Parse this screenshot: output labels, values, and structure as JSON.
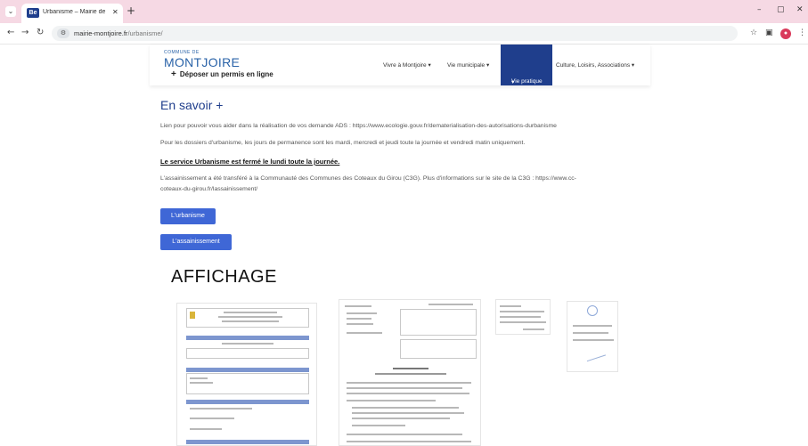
{
  "browser": {
    "tab_title": "Urbanisme – Mairie de Montjo",
    "tab_favicon": "Be",
    "url_host": "mairie-montjoire.fr",
    "url_path": "/urbanisme/"
  },
  "site": {
    "logo_small": "COMMUNE DE",
    "logo_main": "MONTJOIRE",
    "permis_plus": "+",
    "permis_label": "Déposer un permis en ligne",
    "nav": [
      {
        "label": "Vivre à Montjoire"
      },
      {
        "label": "Vie municipale"
      },
      {
        "label": "Vie pratique"
      },
      {
        "label": "Culture, Loisirs, Associations"
      }
    ],
    "nav_caret": "▾"
  },
  "content": {
    "heading": "En savoir +",
    "para1": "Lien pour pouvoir vous aider dans la réalisation de vos demande ADS : https://www.ecologie.gouv.fr/dematerialisation-des-autorisations-durbanisme",
    "para2": "Pour les dossiers d'urbanisme, les jours de permanence sont les mardi, mercredi et jeudi toute la journée et vendredi matin uniquement.",
    "bold_line": "Le service Urbanisme est fermé le lundi toute la journée.",
    "para3_line1": "L'assainissement a été transféré à la Communauté des Communes des Coteaux du Girou (C3G). Plus d'informations sur le site de la C3G : https://www.cc-",
    "para3_line2": "coteaux-du-girou.fr/lassainissement/",
    "btn_urbanisme": "L'urbanisme",
    "btn_assainissement": "L'assainissement",
    "affichage": "AFFICHAGE"
  },
  "icons": {
    "tab_menu": "⌄",
    "close": "✕",
    "new_tab": "+",
    "back": "←",
    "forward": "→",
    "reload": "↻",
    "site_info": "⚙",
    "star": "☆",
    "sidebar": "▣",
    "menu": "⋮",
    "minimize": "–",
    "maximize": "▢"
  },
  "colors": {
    "tabstrip": "#f6d9e4",
    "brand_blue": "#1f3e8c",
    "button_blue": "#3f67d6"
  }
}
